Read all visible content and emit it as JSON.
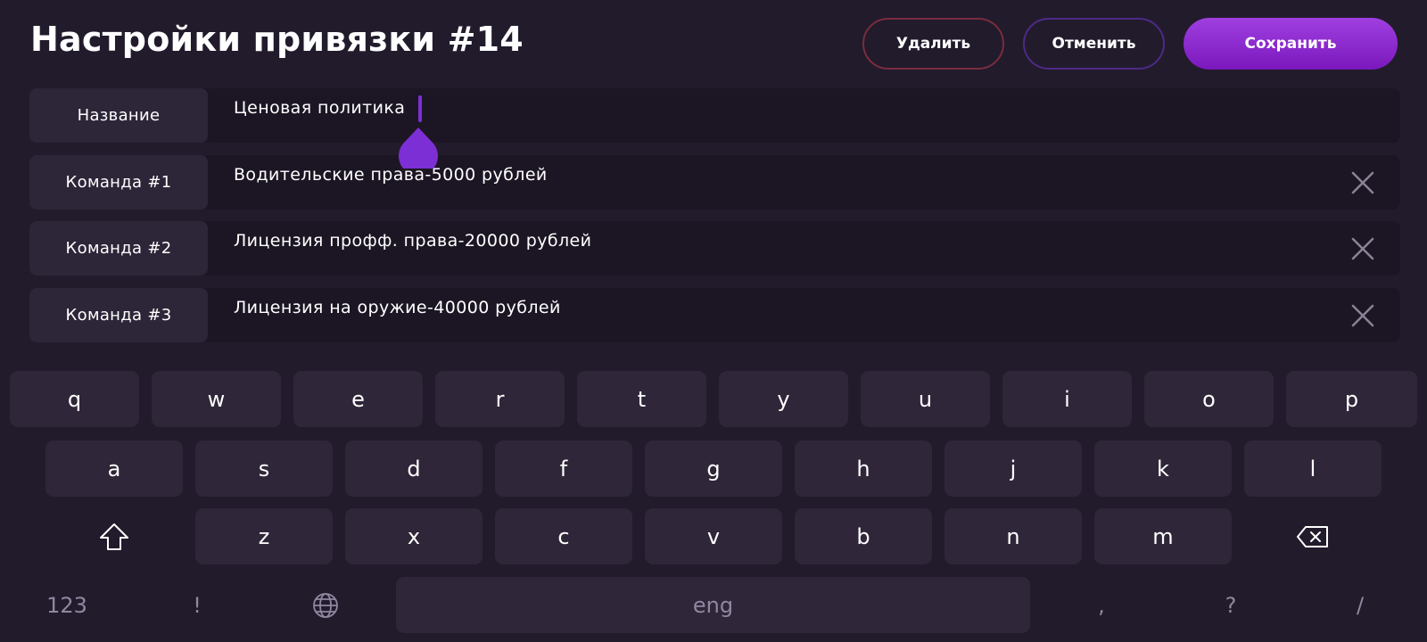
{
  "header": {
    "title": "Настройки привязки #14",
    "delete_label": "Удалить",
    "cancel_label": "Отменить",
    "save_label": "Сохранить"
  },
  "fields": [
    {
      "label": "Название",
      "value": "Ценовая политика"
    },
    {
      "label": "Команда #1",
      "value": "Водительские права-5000 рублей"
    },
    {
      "label": "Команда #2",
      "value": "Лицензия профф. права-20000 рублей"
    },
    {
      "label": "Команда #3",
      "value": "Лицензия на оружие-40000 рублей"
    }
  ],
  "keyboard": {
    "row1": [
      "q",
      "w",
      "e",
      "r",
      "t",
      "y",
      "u",
      "i",
      "o",
      "p"
    ],
    "row2": [
      "a",
      "s",
      "d",
      "f",
      "g",
      "h",
      "j",
      "k",
      "l"
    ],
    "row3": [
      "z",
      "x",
      "c",
      "v",
      "b",
      "n",
      "m"
    ],
    "numbers_label": "123",
    "exclaim_label": "!",
    "space_label": "eng",
    "comma_label": ",",
    "question_label": "?",
    "slash_label": "/"
  },
  "colors": {
    "background": "#221b2c",
    "accent": "#7c2fd4",
    "delete_border": "#7a2c3e",
    "cancel_border": "#4d2a86"
  },
  "icons": {
    "clear": "close-icon",
    "shift": "shift-icon",
    "backspace": "backspace-icon",
    "language": "globe-icon"
  }
}
